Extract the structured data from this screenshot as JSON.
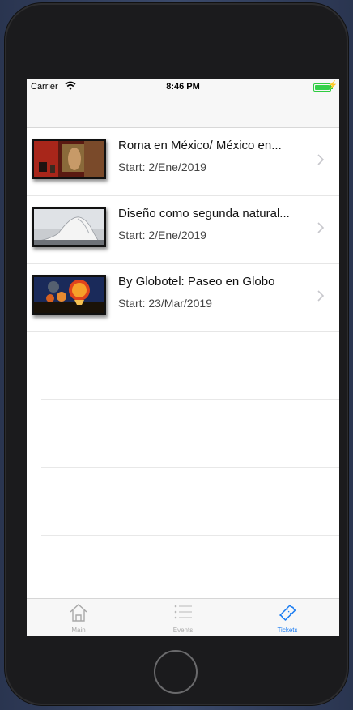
{
  "status_bar": {
    "carrier": "Carrier",
    "time": "8:46 PM"
  },
  "events": [
    {
      "title": "Roma en México/ México en...",
      "start": "Start: 2/Ene/2019",
      "image": "museum-photo"
    },
    {
      "title": "Diseño como segunda natural...",
      "start": "Start: 2/Ene/2019",
      "image": "architecture-photo"
    },
    {
      "title": "By Globotel: Paseo en Globo",
      "start": "Start: 23/Mar/2019",
      "image": "balloon-photo"
    }
  ],
  "tabbar": {
    "items": [
      {
        "label": "Main",
        "icon": "home-icon",
        "active": false
      },
      {
        "label": "Events",
        "icon": "list-icon",
        "active": false
      },
      {
        "label": "Tickets",
        "icon": "ticket-icon",
        "active": true
      }
    ]
  },
  "colors": {
    "accent": "#1a7cf2",
    "inactive": "#a8a8a8",
    "battery": "#35d04a"
  }
}
